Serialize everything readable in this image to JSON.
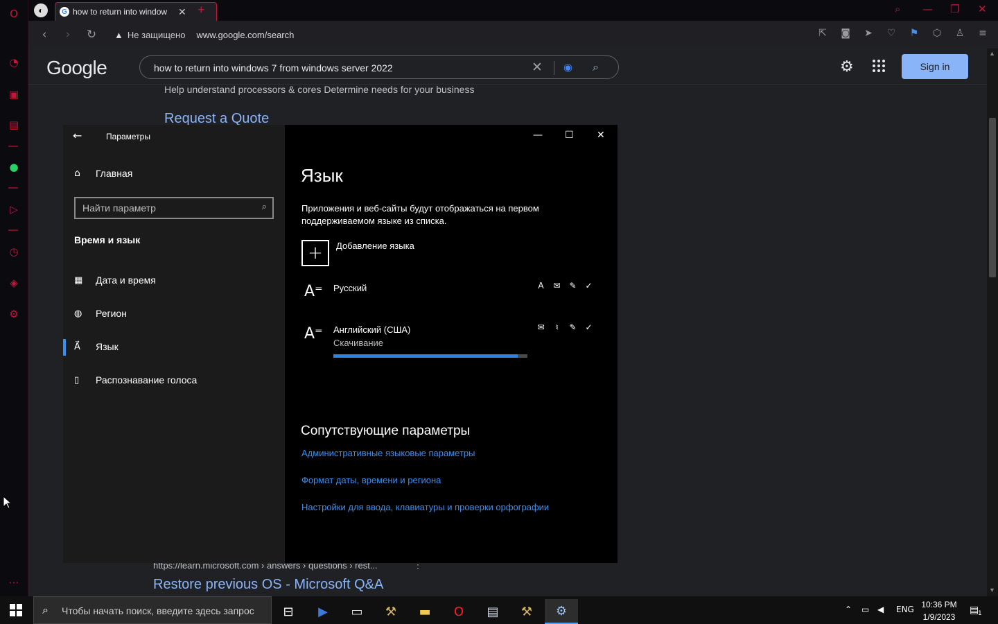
{
  "browser": {
    "tab_title": "how to return into window",
    "tab_favicon": "G",
    "security_label": "Не защищено",
    "url": "www.google.com/search"
  },
  "google": {
    "logo": "Google",
    "query": "how to return into windows 7 from windows server 2022",
    "sign_in": "Sign in",
    "snippet": "Help understand processors & cores Determine needs for your business",
    "quote_link": "Request a Quote",
    "cite": "https://learn.microsoft.com › answers › questions › rest...",
    "result_title": "Restore previous OS - Microsoft Q&A"
  },
  "settings": {
    "app_name": "Параметры",
    "home": "Главная",
    "search_placeholder": "Найти параметр",
    "section": "Время и язык",
    "nav": [
      {
        "label": "Дата и время",
        "icon": "calendar-clock-icon"
      },
      {
        "label": "Регион",
        "icon": "globe-icon"
      },
      {
        "label": "Язык",
        "icon": "language-icon"
      },
      {
        "label": "Распознавание голоса",
        "icon": "microphone-icon"
      }
    ],
    "selected_nav": "Язык",
    "page_title": "Язык",
    "description": "Приложения и веб-сайты будут отображаться на первом поддерживаемом языке из списка.",
    "add_language": "Добавление языка",
    "languages": [
      {
        "name": "Русский",
        "status": ""
      },
      {
        "name": "Английский (США)",
        "status": "Скачивание",
        "progress": 0.95
      }
    ],
    "related_title": "Сопутствующие параметры",
    "related_links": [
      "Административные языковые параметры",
      "Формат даты, времени и региона",
      "Настройки для ввода, клавиатуры и проверки орфографии"
    ]
  },
  "taskbar": {
    "search_placeholder": "Чтобы начать поиск, введите здесь запрос",
    "lang": "ENG",
    "time": "10:36 PM",
    "date": "1/9/2023",
    "notif_count": "1"
  },
  "colors": {
    "opera_red": "#c2173d",
    "link_blue": "#8ab4f8",
    "win_accent": "#3a8ff0"
  }
}
